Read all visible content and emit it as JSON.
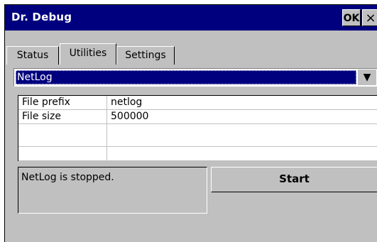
{
  "window": {
    "title": "Dr. Debug",
    "ok_label": "OK",
    "close_glyph": "×"
  },
  "tabs": [
    {
      "label": "Status"
    },
    {
      "label": "Utilities",
      "selected": true
    },
    {
      "label": "Settings"
    }
  ],
  "dropdown": {
    "selected": "NetLog",
    "arrow_glyph": "▼"
  },
  "properties": [
    {
      "key": "File prefix",
      "value": "netlog"
    },
    {
      "key": "File size",
      "value": "500000"
    },
    {
      "key": "",
      "value": ""
    },
    {
      "key": "",
      "value": ""
    }
  ],
  "status": {
    "text": "NetLog is stopped."
  },
  "actions": {
    "start_label": "Start"
  },
  "colors": {
    "titlebar": "#00007f",
    "face": "#c0c0c0",
    "selection": "#00007f"
  }
}
